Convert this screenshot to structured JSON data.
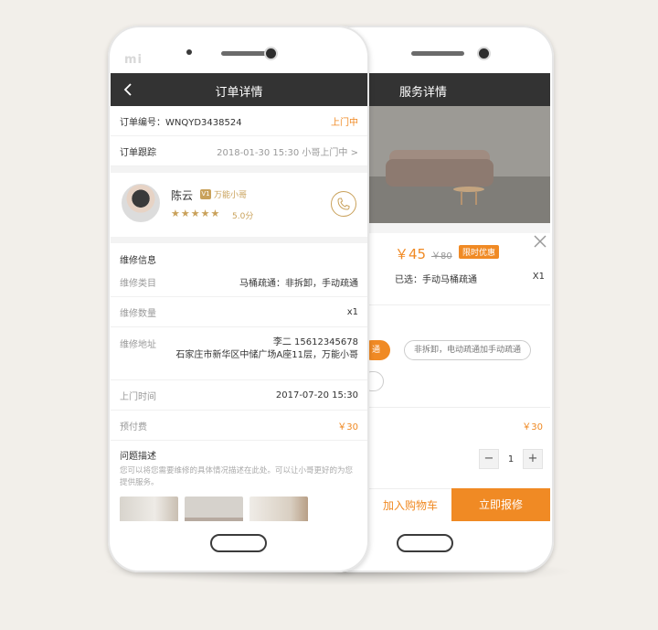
{
  "colors": {
    "accent": "#f08a24",
    "gold": "#c9a15a",
    "titlebar": "#333333"
  },
  "front": {
    "brand": "mi",
    "title": "订单详情",
    "order_no_label": "订单编号：",
    "order_no": "WNQYD3438524",
    "order_status": "上门中",
    "tracking_label": "订单跟踪",
    "tracking_value": "2018-01-30  15:30   小哥上门中",
    "tracking_chevron": ">",
    "worker": {
      "name": "陈云",
      "badge_v": "V1",
      "badge_text": "万能小哥",
      "stars": "★★★★★",
      "score": "5.0分"
    },
    "repair_section": "维修信息",
    "fields": {
      "category_label": "维修类目",
      "category_value": "马桶疏通：非拆卸，手动疏通",
      "qty_label": "维修数量",
      "qty_value": "x1",
      "address_label": "维修地址",
      "address_line1": "李二  15612345678",
      "address_line2": "石家庄市新华区中储广场A座11层，万能小哥",
      "time_label": "上门时间",
      "time_value": "2017-07-20  15:30",
      "prepay_label": "预付费",
      "prepay_value": "￥30"
    },
    "problem_title": "问题描述",
    "problem_desc": "您可以将您需要维修的具体情况描述在此处。可以让小哥更好的为您提供服务。"
  },
  "back": {
    "title": "服务详情",
    "price": "￥45",
    "old_price": "￥80",
    "promo": "限时优惠",
    "selected": "已选：手动马桶疏通",
    "qty": "X1",
    "chip_active": "通",
    "chip_other": "非拆卸，电动疏通加手动疏通",
    "fee": "￥30",
    "stepper_minus": "−",
    "stepper_value": "1",
    "stepper_plus": "+",
    "add_cart": "加入购物车",
    "buy_now": "立即报修"
  }
}
